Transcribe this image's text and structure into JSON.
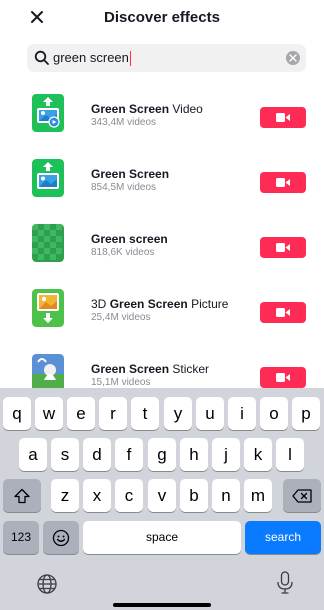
{
  "header": {
    "title": "Discover effects"
  },
  "search": {
    "value": "green screen"
  },
  "results": [
    {
      "name_bold": "Green Screen",
      "name_rest": " Video",
      "name_prefix": "",
      "count": "343,4M videos"
    },
    {
      "name_bold": "Green Screen",
      "name_rest": "",
      "name_prefix": "",
      "count": "854,5M videos"
    },
    {
      "name_bold": "Green screen",
      "name_rest": "",
      "name_prefix": "",
      "count": "818,6K videos"
    },
    {
      "name_bold": "Green Screen",
      "name_rest": " Picture",
      "name_prefix": "3D ",
      "count": "25,4M videos"
    },
    {
      "name_bold": "Green Screen",
      "name_rest": " Sticker",
      "name_prefix": "",
      "count": "15,1M videos"
    }
  ],
  "keyboard": {
    "row1": [
      "q",
      "w",
      "e",
      "r",
      "t",
      "y",
      "u",
      "i",
      "o",
      "p"
    ],
    "row2": [
      "a",
      "s",
      "d",
      "f",
      "g",
      "h",
      "j",
      "k",
      "l"
    ],
    "row3": [
      "z",
      "x",
      "c",
      "v",
      "b",
      "n",
      "m"
    ],
    "numbers_label": "123",
    "space_label": "space",
    "search_label": "search"
  },
  "colors": {
    "accent": "#fe2c55",
    "keyboard_bg": "#d1d4da",
    "search_key": "#0a7aff"
  }
}
